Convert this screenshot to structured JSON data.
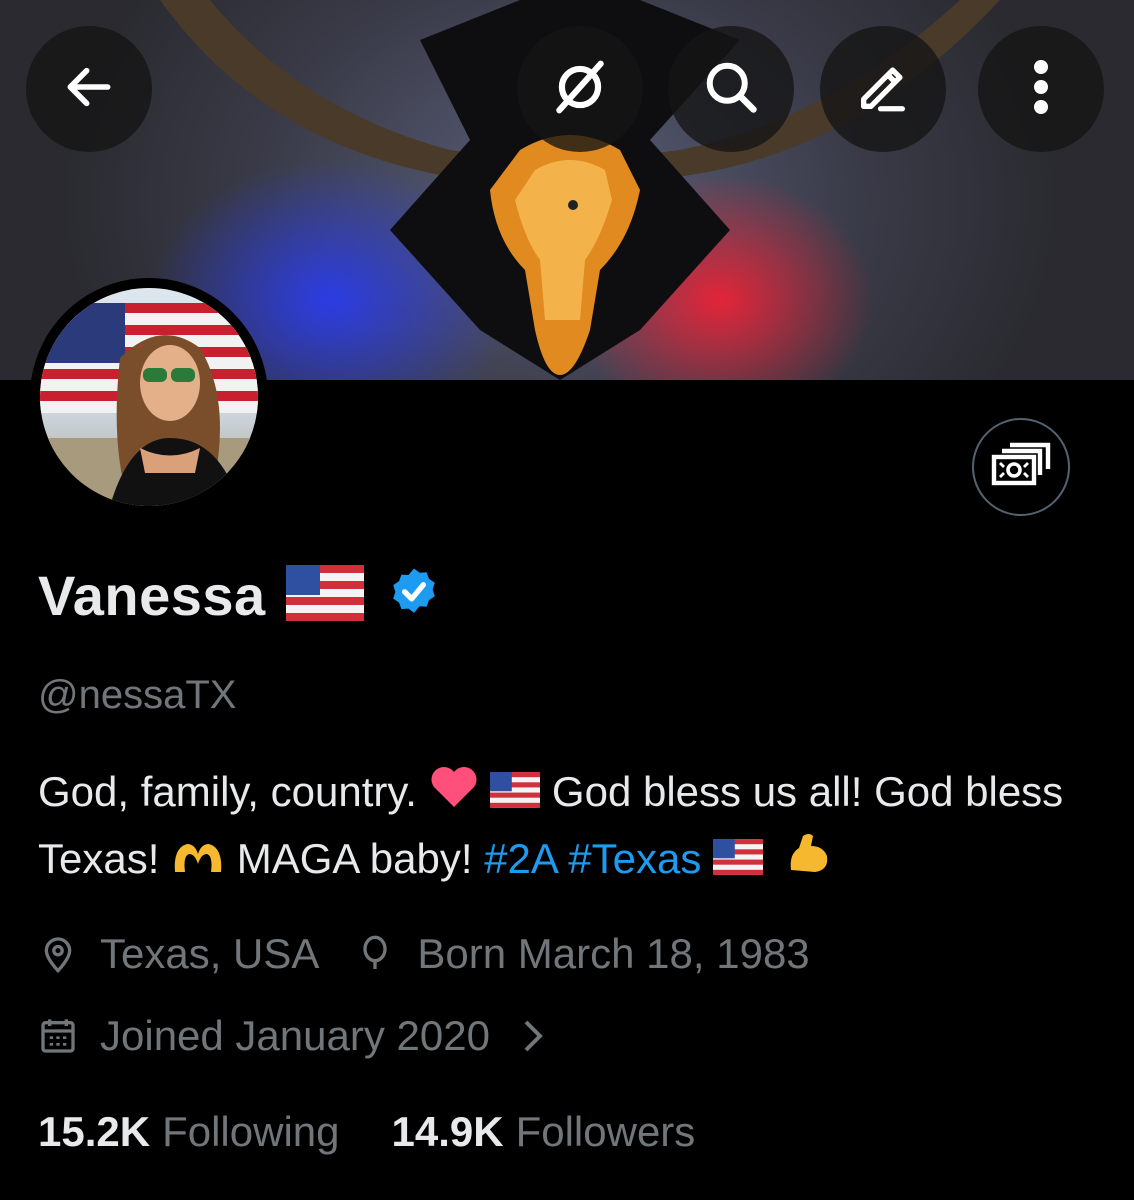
{
  "header": {
    "back_icon": "arrow-left-icon",
    "grok_icon": "grok-icon",
    "search_icon": "search-icon",
    "edit_icon": "pencil-icon",
    "more_icon": "more-vertical-icon"
  },
  "profile": {
    "name": "Vanessa",
    "handle": "@nessaTX",
    "verified": true,
    "bio": {
      "part1": "God, family, country.",
      "part2": "God bless us all! God bless Texas!",
      "part3": "MAGA baby!",
      "hashtag1": "#2A",
      "hashtag2": "#Texas"
    },
    "location": "Texas, USA",
    "birthday": "Born March 18, 1983",
    "joined": "Joined January 2020",
    "following_count": "15.2K",
    "following_label": "Following",
    "followers_count": "14.9K",
    "followers_label": "Followers"
  },
  "colors": {
    "accent": "#1d9bf0",
    "secondary_text": "#71767b",
    "primary_text": "#e7e9ea",
    "background": "#000000"
  }
}
